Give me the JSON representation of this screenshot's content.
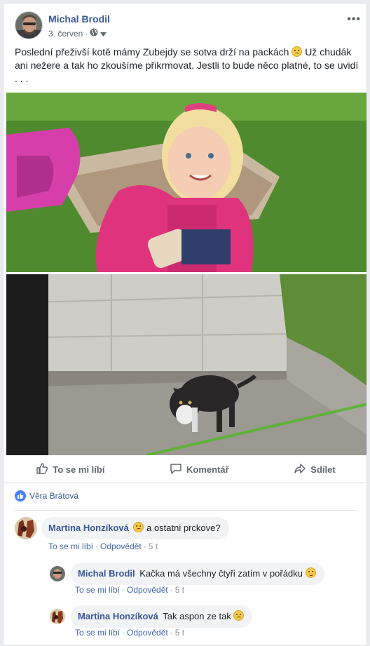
{
  "post": {
    "author": "Michal Brodil",
    "date": "3. červen",
    "separator": "·",
    "privacy_icon": "globe-icon",
    "more_label": "•••",
    "text_part1": "Poslední přeživší kotě mámy Zubejdy se sotva drží na packách",
    "text_part2": "Už chudák ani nežere a tak ho zkoušíme přikrmovat. Jestli to bude něco platné, to se uvidí . . ."
  },
  "photos": [
    {
      "subject": "child-with-bottle-photo"
    },
    {
      "subject": "kitten-on-concrete-photo"
    }
  ],
  "actions": {
    "like": "To se mi líbí",
    "comment": "Komentář",
    "share": "Sdílet"
  },
  "reactions": {
    "names": "Věra Brátová"
  },
  "comments": [
    {
      "author": "Martina Honzíková",
      "text": "a ostatni prckove?",
      "emoji_before_text": true,
      "like": "To se mi líbí",
      "reply": "Odpovědět",
      "time": "5 t"
    },
    {
      "author": "Michal Brodil",
      "text": "Kačka má všechny čtyři zatím v pořádku",
      "like": "To se mi líbí",
      "reply": "Odpovědět",
      "time": "5 t"
    },
    {
      "author": "Martina Honzíková",
      "text": "Tak aspon ze tak",
      "like": "To se mi líbí",
      "reply": "Odpovědět",
      "time": "5 t"
    }
  ],
  "colors": {
    "link": "#365899",
    "action_text": "#606770",
    "like_blue": "#4a7ef5",
    "bubble": "#f2f3f5"
  }
}
